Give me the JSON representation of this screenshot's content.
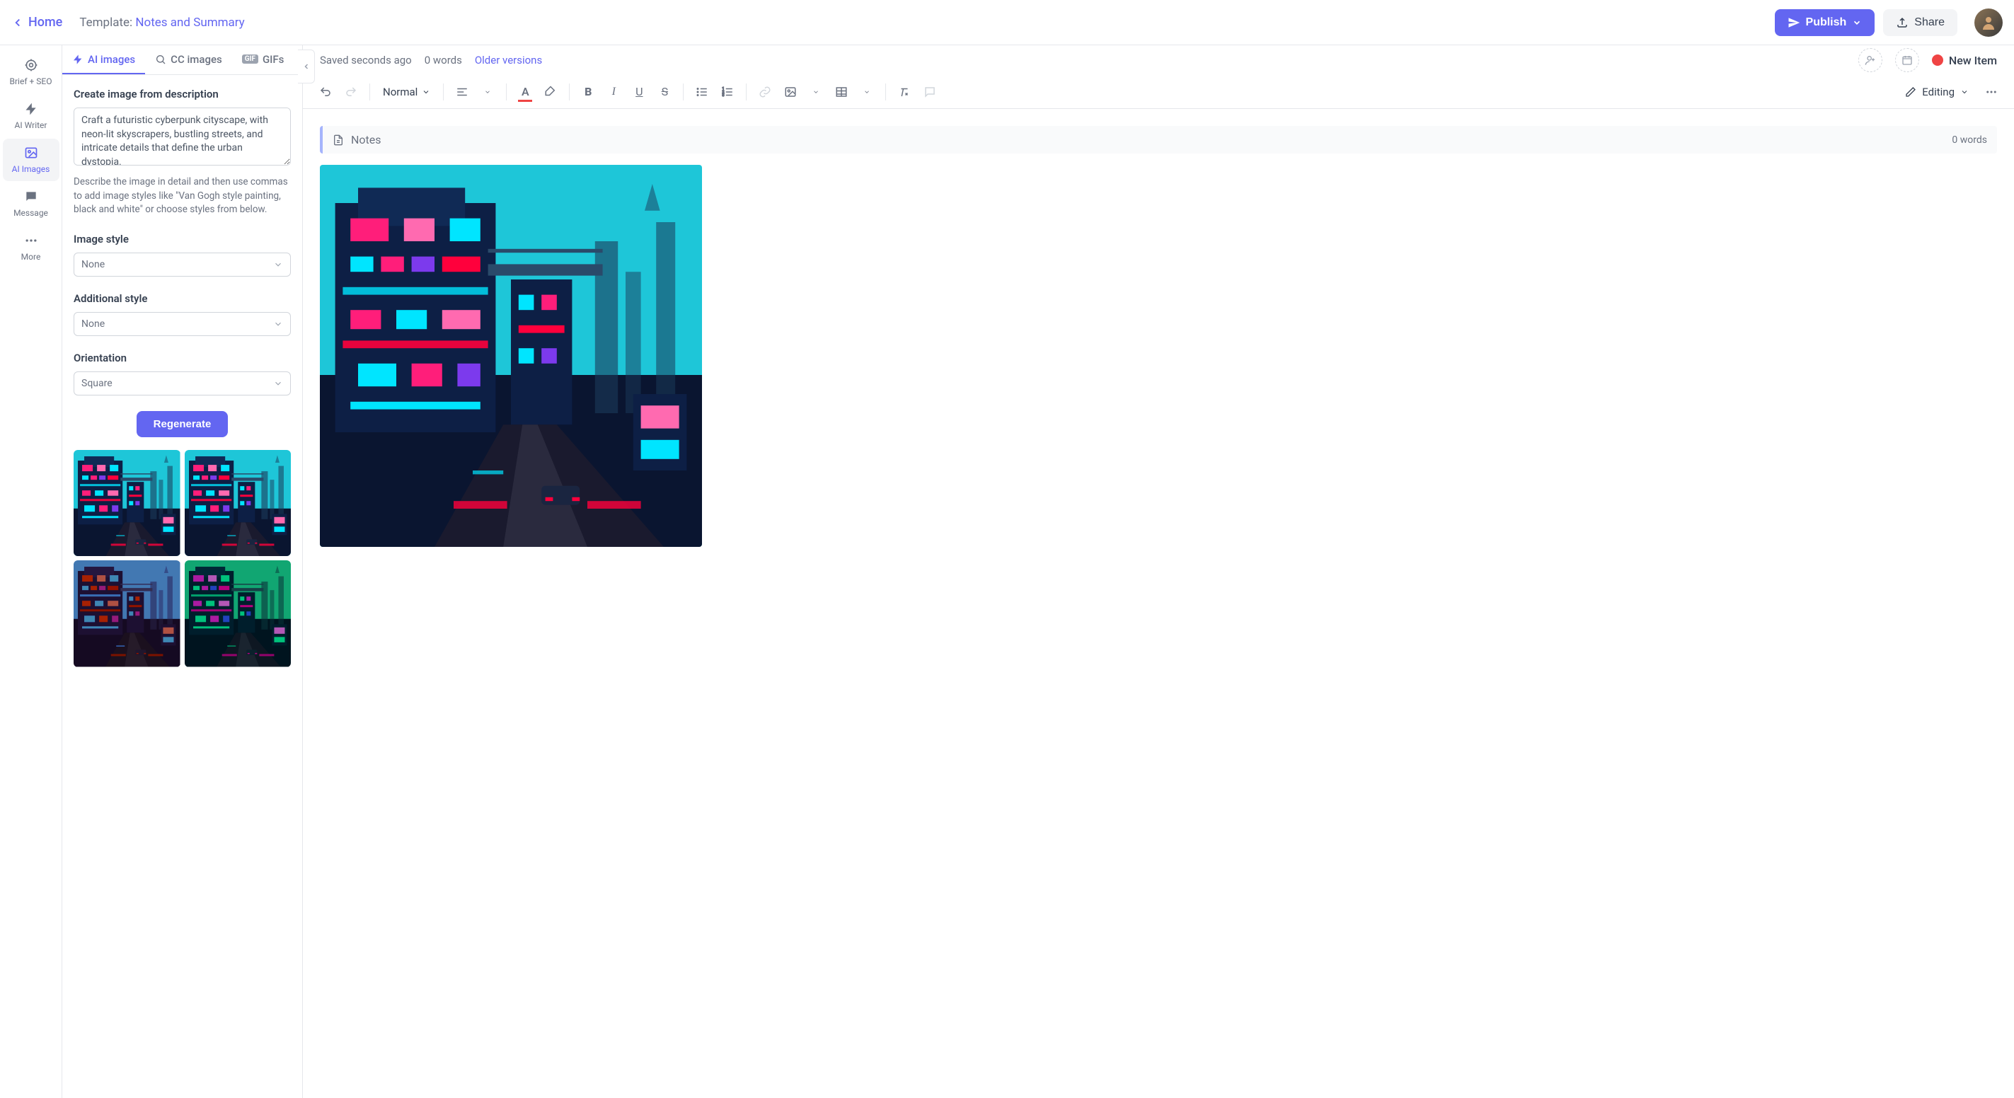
{
  "header": {
    "home": "Home",
    "template_prefix": "Template: ",
    "template_name": "Notes and Summary",
    "publish": "Publish",
    "share": "Share"
  },
  "sidenav": {
    "items": [
      {
        "label": "Brief + SEO"
      },
      {
        "label": "AI Writer"
      },
      {
        "label": "AI Images"
      },
      {
        "label": "Message"
      },
      {
        "label": "More"
      }
    ],
    "active_index": 2
  },
  "panel": {
    "tabs": {
      "ai_images": "AI images",
      "cc_images": "CC images",
      "gifs": "GIFs",
      "gif_badge": "GIF"
    },
    "create_label": "Create image from description",
    "prompt": "Craft a futuristic cyberpunk cityscape, with neon-lit skyscrapers, bustling streets, and intricate details that define the urban dystopia.",
    "helper": "Describe the image in detail and then use commas to add image styles like \"Van Gogh style painting, black and white\" or choose styles from below.",
    "image_style_label": "Image style",
    "image_style_value": "None",
    "additional_style_label": "Additional style",
    "additional_style_value": "None",
    "orientation_label": "Orientation",
    "orientation_value": "Square",
    "regenerate": "Regenerate"
  },
  "editor": {
    "saved": "Saved seconds ago",
    "words_top": "0 words",
    "older": "Older versions",
    "new_item": "New Item",
    "para_style": "Normal",
    "mode": "Editing",
    "notes_label": "Notes",
    "notes_words": "0 words"
  },
  "colors": {
    "accent": "#6366f1",
    "sky": "#2dd4e0",
    "neon_pink": "#ff1e7a",
    "neon_cyan": "#00e5ff",
    "dark": "#0a1a3a"
  }
}
